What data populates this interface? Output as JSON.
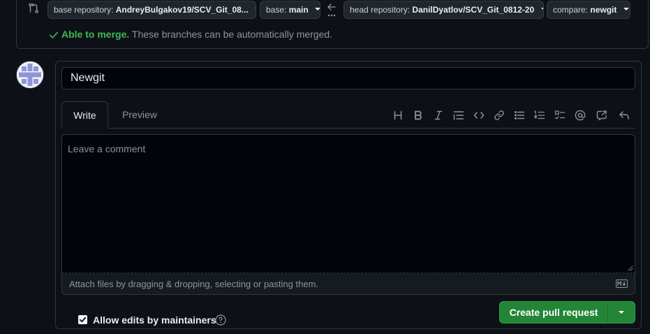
{
  "compare_bar": {
    "base_repository": {
      "label": "base repository:",
      "value": "AndreyBulgakov19/SCV_Git_08..."
    },
    "base": {
      "label": "base:",
      "value": "main"
    },
    "head_repository": {
      "label": "head repository:",
      "value": "DanilDyatlov/SCV_Git_0812-20"
    },
    "compare": {
      "label": "compare:",
      "value": "newgit"
    },
    "merge_status_strong": "Able to merge.",
    "merge_status_text": "These branches can be automatically merged."
  },
  "form": {
    "title_value": "Newgit",
    "tabs": [
      {
        "label": "Write",
        "active": true
      },
      {
        "label": "Preview",
        "active": false
      }
    ],
    "toolbar_icons": [
      "heading-icon",
      "bold-icon",
      "italic-icon",
      "quote-icon",
      "code-icon",
      "link-icon",
      "bulleted-list-icon",
      "numbered-list-icon",
      "task-list-icon",
      "mention-icon",
      "reference-icon",
      "reply-icon"
    ],
    "comment_placeholder": "Leave a comment",
    "attach_text": "Attach files by dragging & dropping, selecting or pasting them.",
    "allow_edits_label": "Allow edits by maintainers",
    "allow_edits_checked": true,
    "submit_label": "Create pull request"
  },
  "colors": {
    "background": "#0d1117",
    "success": "#3fb950",
    "button_green": "#238636",
    "border": "#30363d"
  }
}
